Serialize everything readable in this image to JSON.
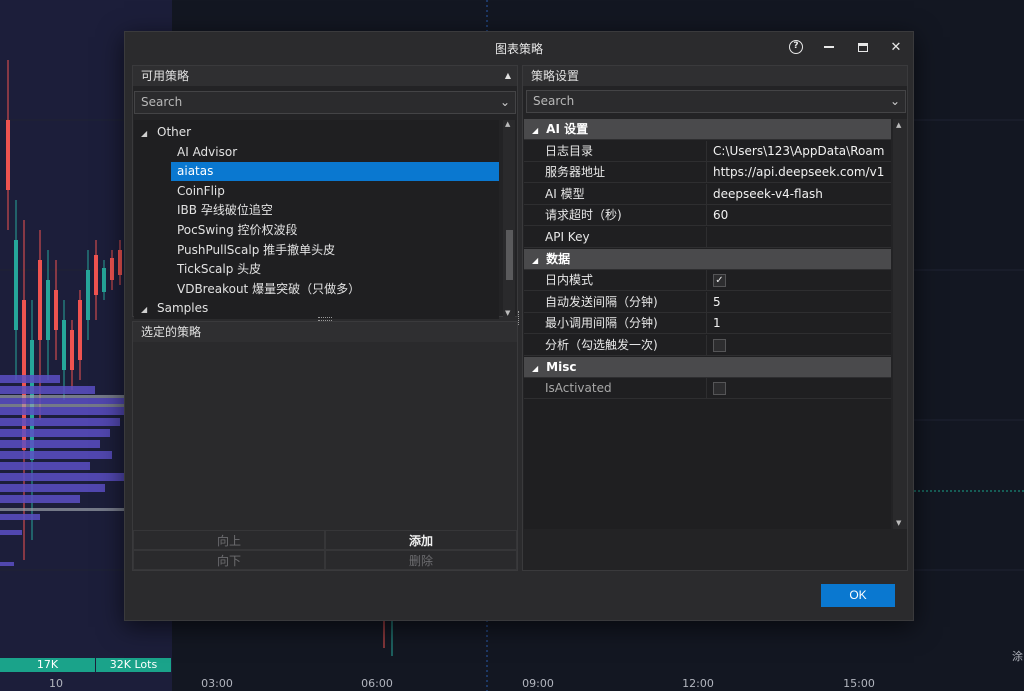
{
  "dialog": {
    "title": "图表策略",
    "help_glyph": "?",
    "minimize_glyph": "—",
    "maximize_glyph": "☐",
    "close_glyph": "✕"
  },
  "available": {
    "header": "可用策略",
    "search_placeholder": "Search",
    "tree": [
      {
        "label": "Other",
        "level": 0,
        "expanded": true,
        "selected": false
      },
      {
        "label": "AI Advisor",
        "level": 1,
        "selected": false
      },
      {
        "label": "aiatas",
        "level": 1,
        "selected": true
      },
      {
        "label": "CoinFlip",
        "level": 1,
        "selected": false
      },
      {
        "label": "IBB 孕线破位追空",
        "level": 1,
        "selected": false
      },
      {
        "label": "PocSwing 控价权波段",
        "level": 1,
        "selected": false
      },
      {
        "label": "PushPullScalp 推手撤单头皮",
        "level": 1,
        "selected": false
      },
      {
        "label": "TickScalp 头皮",
        "level": 1,
        "selected": false
      },
      {
        "label": "VDBreakout 爆量突破（只做多）",
        "level": 1,
        "selected": false
      },
      {
        "label": "Samples",
        "level": 0,
        "expanded": true,
        "selected": false
      }
    ]
  },
  "selected_panel": {
    "header": "选定的策略",
    "buttons": {
      "up": "向上",
      "add": "添加",
      "down": "向下",
      "delete": "删除"
    }
  },
  "settings": {
    "header": "策略设置",
    "search_placeholder": "Search",
    "rows": [
      {
        "type": "category",
        "label": "AI 设置"
      },
      {
        "type": "text",
        "label": "日志目录",
        "value": "C:\\Users\\123\\AppData\\Roam"
      },
      {
        "type": "text",
        "label": "服务器地址",
        "value": "https://api.deepseek.com/v1"
      },
      {
        "type": "text",
        "label": "AI 模型",
        "value": "deepseek-v4-flash"
      },
      {
        "type": "text",
        "label": "请求超时（秒)",
        "value": "60"
      },
      {
        "type": "text",
        "label": "API Key",
        "value": ""
      },
      {
        "type": "category",
        "label": "数据"
      },
      {
        "type": "check",
        "label": "日内模式",
        "checked": true
      },
      {
        "type": "text",
        "label": "自动发送间隔（分钟)",
        "value": "5"
      },
      {
        "type": "text",
        "label": "最小调用间隔（分钟)",
        "value": "1"
      },
      {
        "type": "check",
        "label": "分析（勾选触发一次)",
        "checked": false
      },
      {
        "type": "category",
        "label": "Misc"
      },
      {
        "type": "check",
        "label": "IsActivated",
        "checked": false,
        "dim": true
      }
    ]
  },
  "ok_label": "OK",
  "background": {
    "time_labels": [
      "10",
      "03:00",
      "06:00",
      "09:00",
      "12:00",
      "15:00"
    ],
    "volume_labels": [
      "17K",
      "32K Lots"
    ],
    "edge_label": "涂",
    "up_color": "#26a69a",
    "down_color": "#ef5350",
    "profile_color": "#5b4fc4"
  }
}
